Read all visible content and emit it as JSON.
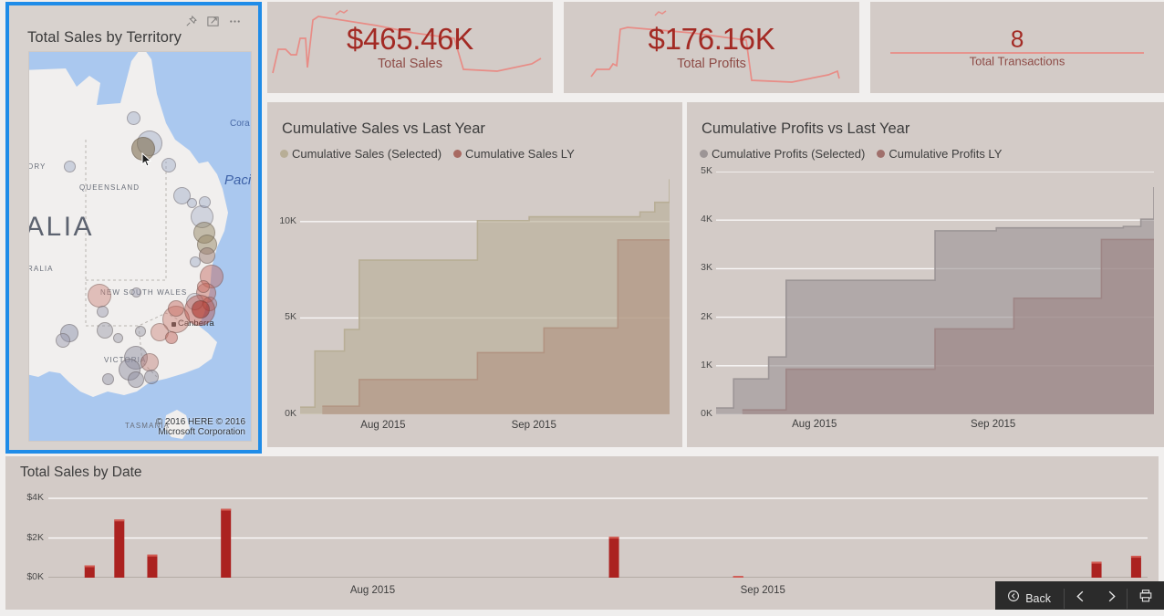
{
  "theme": {
    "card_bg": "#d3cbc7",
    "selection_outline": "#1f8ce8",
    "accent_red": "#a32a24",
    "bar_red": "#ab2220",
    "series_selected": "#b8ae96",
    "series_ly": "#a86a62",
    "profits_selected": "#9c9596",
    "profits_ly": "#a0706c",
    "map_water": "#aac8ef",
    "map_land": "#f1efee"
  },
  "map_card": {
    "title": "Total Sales by Territory",
    "icons": [
      "pin-icon",
      "focus-mode-icon",
      "more-options-icon"
    ],
    "attribution_line1": "© 2016 HERE    © 2016",
    "attribution_line2": "Microsoft Corporation",
    "labels": {
      "country": "ALIA",
      "territory_partial": "ORY",
      "australia_partial": "RALIA",
      "queensland": "QUEENSLAND",
      "new_south_wales": "NEW SOUTH WALES",
      "victoria": "VICTORIA",
      "tasmania": "TASMANIA",
      "canberra": "Canberra",
      "coral_sea": "Cora",
      "pacific": "Pacif"
    }
  },
  "kpis": [
    {
      "name": "total-sales",
      "value": "$465.46K",
      "label": "Total Sales"
    },
    {
      "name": "total-profits",
      "value": "$176.16K",
      "label": "Total Profits"
    },
    {
      "name": "total-transactions",
      "value": "8",
      "label": "Total Transactions"
    }
  ],
  "sales_card": {
    "title": "Cumulative Sales vs Last Year",
    "legend": [
      {
        "label": "Cumulative Sales (Selected)",
        "color": "#b8ae96"
      },
      {
        "label": "Cumulative Sales LY",
        "color": "#a86a62"
      }
    ]
  },
  "profits_card": {
    "title": "Cumulative Profits vs Last Year",
    "legend": [
      {
        "label": "Cumulative Profits (Selected)",
        "color": "#9c9596"
      },
      {
        "label": "Cumulative Profits LY",
        "color": "#a0706c"
      }
    ]
  },
  "bars_card": {
    "title": "Total Sales by Date"
  },
  "nav": {
    "back_label": "Back",
    "back_icon": "back-circle-icon",
    "prev_icon": "chevron-left-icon",
    "next_icon": "chevron-right-icon",
    "print_icon": "printer-icon"
  },
  "chart_data": [
    {
      "type": "area",
      "name": "cumulative-sales-vs-last-year",
      "title": "Cumulative Sales vs Last Year",
      "xlabel": "",
      "ylabel": "",
      "ylim": [
        0,
        12500
      ],
      "yticks": [
        "0K",
        "5K",
        "10K"
      ],
      "ytick_values": [
        0,
        5000,
        10000
      ],
      "xticks": [
        "Aug 2015",
        "Sep 2015"
      ],
      "grid": true,
      "legend_position": "top-left",
      "step": true,
      "series": [
        {
          "name": "Cumulative Sales (Selected)",
          "color": "#b8ae96",
          "x": [
            0.0,
            0.04,
            0.07,
            0.12,
            0.16,
            0.45,
            0.48,
            0.58,
            0.62,
            0.88,
            0.92,
            0.96,
            1.0
          ],
          "values": [
            370,
            3280,
            3280,
            4400,
            8000,
            8000,
            10050,
            10050,
            10250,
            10250,
            10500,
            11000,
            12200
          ]
        },
        {
          "name": "Cumulative Sales LY",
          "color": "#a86a62",
          "x": [
            0.06,
            0.12,
            0.16,
            0.45,
            0.48,
            0.62,
            0.66,
            0.82,
            0.86,
            1.0
          ],
          "values": [
            420,
            420,
            1800,
            1800,
            3200,
            3200,
            4480,
            4480,
            9050,
            9050
          ]
        }
      ]
    },
    {
      "type": "area",
      "name": "cumulative-profits-vs-last-year",
      "title": "Cumulative Profits vs Last Year",
      "xlabel": "",
      "ylabel": "",
      "ylim": [
        0,
        5000
      ],
      "yticks": [
        "0K",
        "1K",
        "2K",
        "3K",
        "4K",
        "5K"
      ],
      "ytick_values": [
        0,
        1000,
        2000,
        3000,
        4000,
        5000
      ],
      "xticks": [
        "Aug 2015",
        "Sep 2015"
      ],
      "grid": true,
      "legend_position": "top-left",
      "step": true,
      "series": [
        {
          "name": "Cumulative Profits (Selected)",
          "color": "#9c9596",
          "x": [
            0.0,
            0.04,
            0.07,
            0.12,
            0.16,
            0.47,
            0.5,
            0.6,
            0.64,
            0.9,
            0.93,
            0.97,
            1.0
          ],
          "values": [
            130,
            730,
            730,
            1180,
            2760,
            2760,
            3780,
            3780,
            3840,
            3840,
            3870,
            4020,
            4680
          ]
        },
        {
          "name": "Cumulative Profits LY",
          "color": "#a0706c",
          "x": [
            0.06,
            0.12,
            0.16,
            0.47,
            0.5,
            0.64,
            0.68,
            0.84,
            0.88,
            1.0
          ],
          "values": [
            90,
            90,
            930,
            930,
            1760,
            1760,
            2390,
            2390,
            3600,
            3600
          ]
        }
      ]
    },
    {
      "type": "bar",
      "name": "total-sales-by-date",
      "title": "Total Sales by Date",
      "xlabel": "",
      "ylabel": "",
      "ylim": [
        0,
        4600
      ],
      "yticks": [
        "$0K",
        "$2K",
        "$4K"
      ],
      "ytick_values": [
        0,
        2000,
        4000
      ],
      "xticks": [
        "Aug 2015",
        "Sep 2015"
      ],
      "grid": true,
      "bar_color": "#ab2220",
      "points": [
        {
          "x_frac": 0.033,
          "value": 620
        },
        {
          "x_frac": 0.06,
          "value": 2930
        },
        {
          "x_frac": 0.09,
          "value": 1160
        },
        {
          "x_frac": 0.157,
          "value": 3470
        },
        {
          "x_frac": 0.51,
          "value": 2060
        },
        {
          "x_frac": 0.623,
          "value": 80
        },
        {
          "x_frac": 0.949,
          "value": 800
        },
        {
          "x_frac": 0.985,
          "value": 1100
        }
      ]
    }
  ]
}
